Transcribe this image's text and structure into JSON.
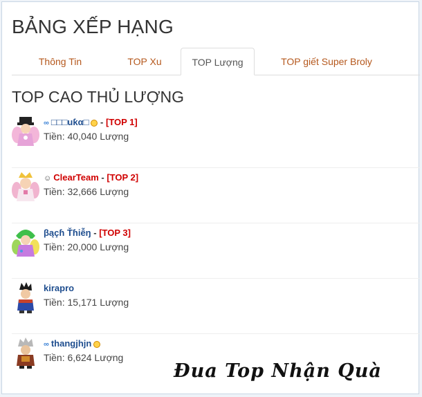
{
  "page": {
    "title": "BẢNG XẾP HẠNG"
  },
  "tabs": [
    {
      "label": "Thông Tin",
      "active": false
    },
    {
      "label": "TOP Xu",
      "active": false
    },
    {
      "label": "TOP Lượng",
      "active": true
    },
    {
      "label": "TOP giết Super Broly",
      "active": false
    }
  ],
  "section": {
    "title": "TOP CAO THỦ LƯỢNG"
  },
  "players": [
    {
      "badge": "∞",
      "name": "□□□uƙα□",
      "vip": true,
      "separator": " - ",
      "rank_tag": "[TOP 1]",
      "money": "Tiền: 40,040 Lượng",
      "avatar": "pink-angel-avatar"
    },
    {
      "badge": "☺",
      "name": "ClearTeam",
      "vip": false,
      "separator": " - ",
      "rank_tag": "[TOP 2]",
      "money": "Tiền: 32,666 Lượng",
      "avatar": "princess-avatar"
    },
    {
      "badge": "",
      "name": "βąçɦ Ťɦiễŋ",
      "vip": false,
      "separator": " - ",
      "rank_tag": "[TOP 3]",
      "money": "Tiền: 20,000 Lượng",
      "avatar": "green-hair-avatar"
    },
    {
      "badge": "",
      "name": "kirapro",
      "vip": false,
      "separator": "",
      "rank_tag": "",
      "money": "Tiền: 15,171 Lượng",
      "avatar": "warrior-avatar"
    },
    {
      "badge": "∞",
      "name": "thangjhjn",
      "vip": true,
      "separator": "",
      "rank_tag": "",
      "money": "Tiền: 6,624 Lượng",
      "avatar": "gray-hair-avatar"
    }
  ],
  "promo": {
    "text": "Đua Top Nhận Quà"
  },
  "colors": {
    "tab_text": "#b5581d",
    "link_blue": "#1f4e8f",
    "top_red": "#d00000"
  }
}
